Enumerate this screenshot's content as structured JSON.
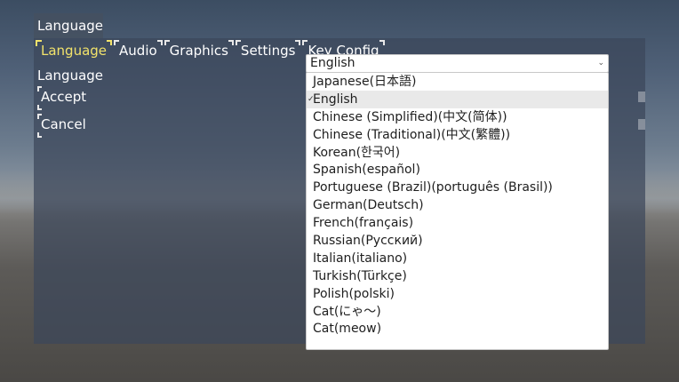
{
  "window": {
    "title": "Language"
  },
  "tabs": [
    {
      "label": "Language",
      "active": true
    },
    {
      "label": "Audio",
      "active": false
    },
    {
      "label": "Graphics",
      "active": false
    },
    {
      "label": "Settings",
      "active": false
    },
    {
      "label": "Key Config",
      "active": false
    }
  ],
  "language_panel": {
    "label": "Language",
    "accept_label": "Accept",
    "cancel_label": "Cancel",
    "selected_value": "English"
  },
  "options": [
    "Japanese(日本語)",
    "English",
    "Chinese (Simplified)(中文(简体))",
    "Chinese (Traditional)(中文(繁體))",
    "Korean(한국어)",
    "Spanish(español)",
    "Portuguese (Brazil)(português (Brasil))",
    "German(Deutsch)",
    "French(français)",
    "Russian(Русский)",
    "Italian(italiano)",
    "Turkish(Türkçe)",
    "Polish(polski)",
    "Cat(にゃ〜)",
    "Cat(meow)"
  ],
  "selected_index": 1,
  "colors": {
    "active_tab": "#f2e36b",
    "panel": "#3c465a",
    "text": "#ffffff"
  }
}
